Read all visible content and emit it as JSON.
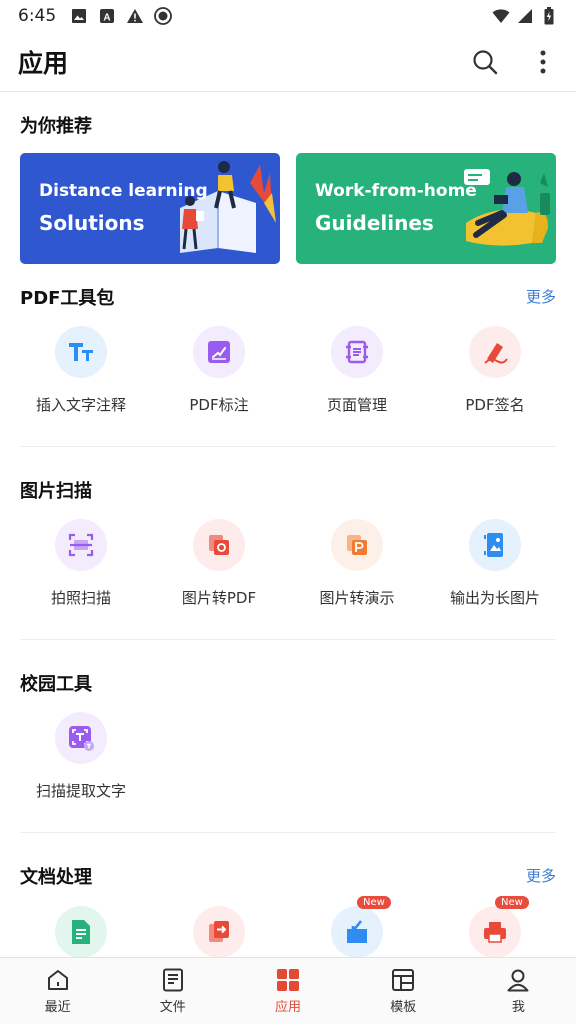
{
  "status_bar": {
    "time": "6:45"
  },
  "app_bar": {
    "title": "应用"
  },
  "recommended": {
    "title": "为你推荐",
    "banners": [
      {
        "line1": "Distance learning",
        "line2": "Solutions",
        "color": "#2f57d0"
      },
      {
        "line1": "Work-from-home",
        "line2": "Guidelines",
        "color": "#27b27c"
      }
    ]
  },
  "pdf_tools": {
    "title": "PDF工具包",
    "more": "更多",
    "items": [
      {
        "label": "插入文字注释",
        "icon": "text-annotation-icon"
      },
      {
        "label": "PDF标注",
        "icon": "pdf-mark-icon"
      },
      {
        "label": "页面管理",
        "icon": "page-manage-icon"
      },
      {
        "label": "PDF签名",
        "icon": "pdf-sign-icon"
      }
    ]
  },
  "scan": {
    "title": "图片扫描",
    "items": [
      {
        "label": "拍照扫描",
        "icon": "photo-scan-icon"
      },
      {
        "label": "图片转PDF",
        "icon": "image-to-pdf-icon"
      },
      {
        "label": "图片转演示",
        "icon": "image-to-ppt-icon"
      },
      {
        "label": "输出为长图片",
        "icon": "long-image-icon"
      }
    ]
  },
  "campus": {
    "title": "校园工具",
    "items": [
      {
        "label": "扫描提取文字",
        "icon": "ocr-icon"
      }
    ]
  },
  "docs": {
    "title": "文档处理",
    "more": "更多",
    "items": [
      {
        "label": "",
        "icon": "doc-convert-icon"
      },
      {
        "label": "",
        "icon": "doc-export-icon"
      },
      {
        "label": "",
        "icon": "doc-import-icon",
        "badge": "New"
      },
      {
        "label": "",
        "icon": "print-icon",
        "badge": "New"
      }
    ]
  },
  "bottom_nav": [
    {
      "label": "最近",
      "icon": "home-icon"
    },
    {
      "label": "文件",
      "icon": "file-icon"
    },
    {
      "label": "应用",
      "icon": "apps-icon",
      "active": true
    },
    {
      "label": "模板",
      "icon": "template-icon"
    },
    {
      "label": "我",
      "icon": "profile-icon"
    }
  ]
}
